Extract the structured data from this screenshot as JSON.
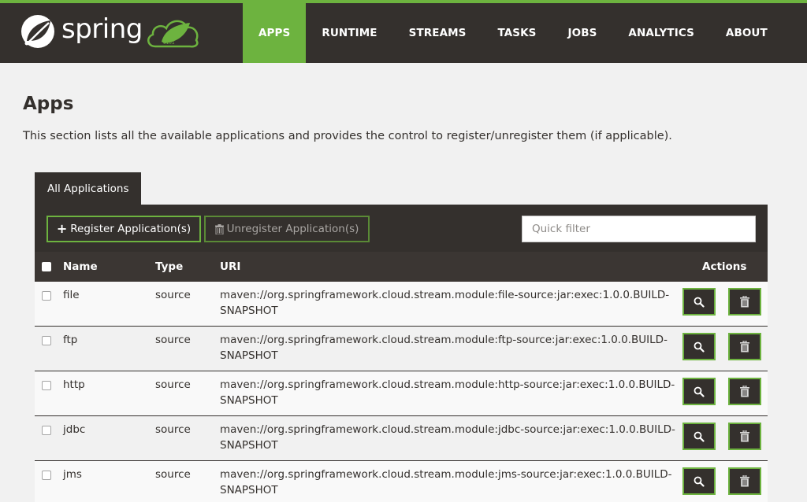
{
  "brand": {
    "name": "spring",
    "accent_color": "#6db33f",
    "header_color": "#34302d"
  },
  "nav": {
    "items": [
      {
        "label": "APPS",
        "active": true
      },
      {
        "label": "RUNTIME",
        "active": false
      },
      {
        "label": "STREAMS",
        "active": false
      },
      {
        "label": "TASKS",
        "active": false
      },
      {
        "label": "JOBS",
        "active": false
      },
      {
        "label": "ANALYTICS",
        "active": false
      },
      {
        "label": "ABOUT",
        "active": false
      }
    ]
  },
  "page": {
    "title": "Apps",
    "description": "This section lists all the available applications and provides the control to register/unregister them (if applicable)."
  },
  "tabs": [
    {
      "label": "All Applications",
      "active": true
    }
  ],
  "toolbar": {
    "register_label": "Register Application(s)",
    "register_icon": "plus-icon",
    "unregister_label": "Unregister Application(s)",
    "unregister_icon": "trash-icon",
    "unregister_disabled": true,
    "filter_placeholder": "Quick filter",
    "filter_value": ""
  },
  "table": {
    "columns": [
      "Name",
      "Type",
      "URI",
      "Actions"
    ],
    "rows": [
      {
        "name": "file",
        "type": "source",
        "uri": "maven://org.springframework.cloud.stream.module:file-source:jar:exec:1.0.0.BUILD-SNAPSHOT",
        "checked": false
      },
      {
        "name": "ftp",
        "type": "source",
        "uri": "maven://org.springframework.cloud.stream.module:ftp-source:jar:exec:1.0.0.BUILD-SNAPSHOT",
        "checked": false
      },
      {
        "name": "http",
        "type": "source",
        "uri": "maven://org.springframework.cloud.stream.module:http-source:jar:exec:1.0.0.BUILD-SNAPSHOT",
        "checked": false
      },
      {
        "name": "jdbc",
        "type": "source",
        "uri": "maven://org.springframework.cloud.stream.module:jdbc-source:jar:exec:1.0.0.BUILD-SNAPSHOT",
        "checked": false
      },
      {
        "name": "jms",
        "type": "source",
        "uri": "maven://org.springframework.cloud.stream.module:jms-source:jar:exec:1.0.0.BUILD-SNAPSHOT",
        "checked": false
      }
    ],
    "row_actions": [
      {
        "name": "details",
        "icon": "search-icon"
      },
      {
        "name": "unregister",
        "icon": "trash-icon"
      }
    ]
  }
}
